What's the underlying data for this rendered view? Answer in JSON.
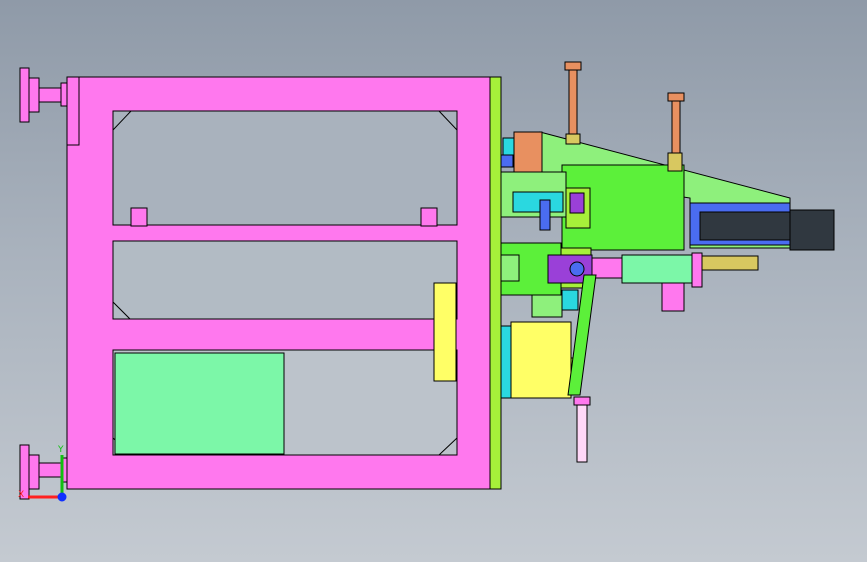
{
  "viewport": {
    "axis_triad": {
      "x_label": "X",
      "y_label": "Y",
      "z_label": "",
      "x_color": "#ff2020",
      "y_color": "#10c010",
      "z_color": "#1030ff"
    },
    "colors": {
      "frame": "#ff78ee",
      "plate": "#a6f03a",
      "green_bright": "#5cf03a",
      "green_light": "#8ef07c",
      "mint": "#7cf7a8",
      "yellow": "#ffff66",
      "cyan": "#2ad8e0",
      "blue": "#4a6cf0",
      "purple": "#9a40d8",
      "copper": "#e89060",
      "gold": "#d8c860",
      "dark_motor": "#303840"
    }
  }
}
